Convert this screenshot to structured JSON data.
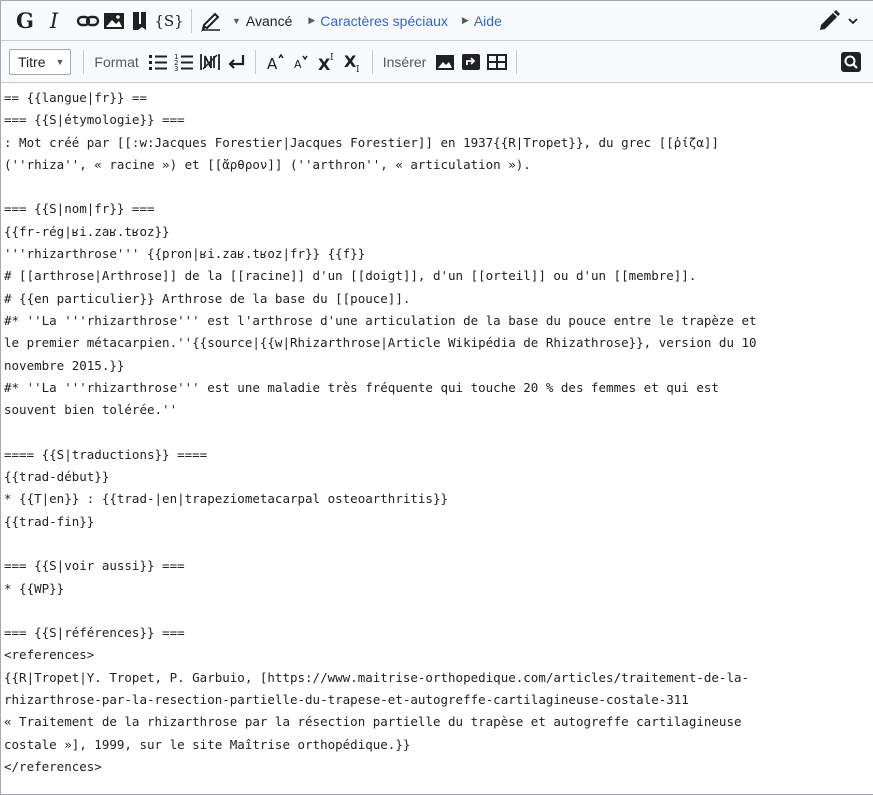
{
  "toolbar1": {
    "bold_label": "G",
    "italic_label": "I",
    "signature_label": "{S}",
    "sections": [
      {
        "label": "Avancé"
      },
      {
        "label": "Caractères spéciaux"
      },
      {
        "label": "Aide"
      }
    ]
  },
  "toolbar2": {
    "heading_select": "Titre",
    "format_label": "Format",
    "insert_label": "Insérer"
  },
  "colors": {
    "accent": "#3366cc",
    "toolbar_bg": "#f8f9fa",
    "border": "#a2a9b1"
  },
  "editor": {
    "lines": [
      "== {{langue|fr}} ==",
      "=== {{S|étymologie}} ===",
      ": Mot créé par [[:w:Jacques Forestier|Jacques Forestier]] en 1937{{R|Tropet}}, du grec [[ῥίζα]]",
      "(''rhiza'', « racine ») et [[ἄρθρον]] (''arthron'', « articulation »).",
      "",
      "=== {{S|nom|fr}} ===",
      "{{fr-rég|ʁi.zaʁ.tʁoz}}",
      "'''rhizarthrose''' {{pron|ʁi.zaʁ.tʁoz|fr}} {{f}}",
      "# [[arthrose|Arthrose]] de la [[racine]] d'un [[doigt]], d'un [[orteil]] ou d'un [[membre]].",
      "# {{en particulier}} Arthrose de la base du [[pouce]].",
      "#* ''La '''rhizarthrose''' est l'arthrose d'une articulation de la base du pouce entre le trapèze et",
      "le premier métacarpien.''{{source|{{w|Rhizarthrose|Article Wikipédia de Rhizathrose}}, version du 10",
      "novembre 2015.}}",
      "#* ''La '''rhizarthrose''' est une maladie très fréquente qui touche 20 % des femmes et qui est",
      "souvent bien tolérée.''",
      "",
      "==== {{S|traductions}} ====",
      "{{trad-début}}",
      "* {{T|en}} : {{trad-|en|trapeziometacarpal osteoarthritis}}",
      "{{trad-fin}}",
      "",
      "=== {{S|voir aussi}} ===",
      "* {{WP}}",
      "",
      "=== {{S|références}} ===",
      "<references>",
      "{{R|Tropet|Y. Tropet, P. Garbuio, [https://www.maitrise-orthopedique.com/articles/traitement-de-la-",
      "rhizarthrose-par-la-resection-partielle-du-trapese-et-autogreffe-cartilagineuse-costale-311",
      "« Traitement de la rhizarthrose par la résection partielle du trapèse et autogreffe cartilagineuse",
      "costale »], 1999, sur le site Maîtrise orthopédique.}}",
      "</references>"
    ]
  }
}
